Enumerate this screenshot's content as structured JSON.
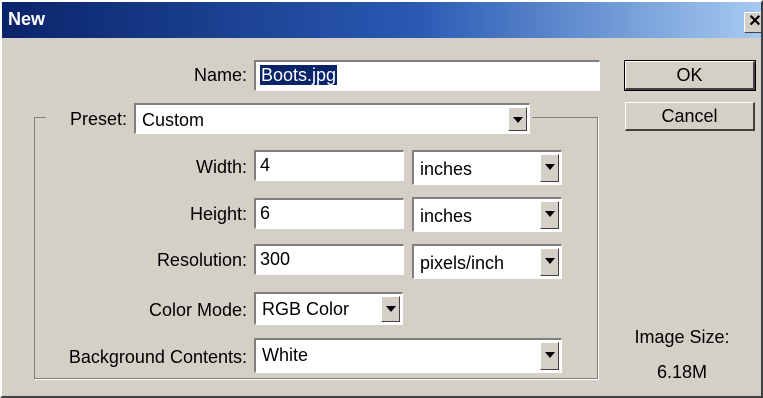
{
  "window": {
    "title": "New",
    "close_glyph": "✕"
  },
  "form": {
    "name": {
      "label": "Name:",
      "value": "Boots.jpg"
    },
    "preset": {
      "label": "Preset:",
      "value": "Custom"
    },
    "width": {
      "label": "Width:",
      "value": "4",
      "unit": "inches"
    },
    "height": {
      "label": "Height:",
      "value": "6",
      "unit": "inches"
    },
    "resolution": {
      "label": "Resolution:",
      "value": "300",
      "unit": "pixels/inch"
    },
    "color_mode": {
      "label": "Color Mode:",
      "value": "RGB Color"
    },
    "background": {
      "label": "Background Contents:",
      "value": "White"
    }
  },
  "buttons": {
    "ok": "OK",
    "cancel": "Cancel"
  },
  "image_size": {
    "label": "Image Size:",
    "value": "6.18M"
  },
  "colors": {
    "title_gradient_start": "#0a246a",
    "title_gradient_end": "#a6caf0",
    "face": "#d4d0c8",
    "selection": "#0a246a"
  }
}
